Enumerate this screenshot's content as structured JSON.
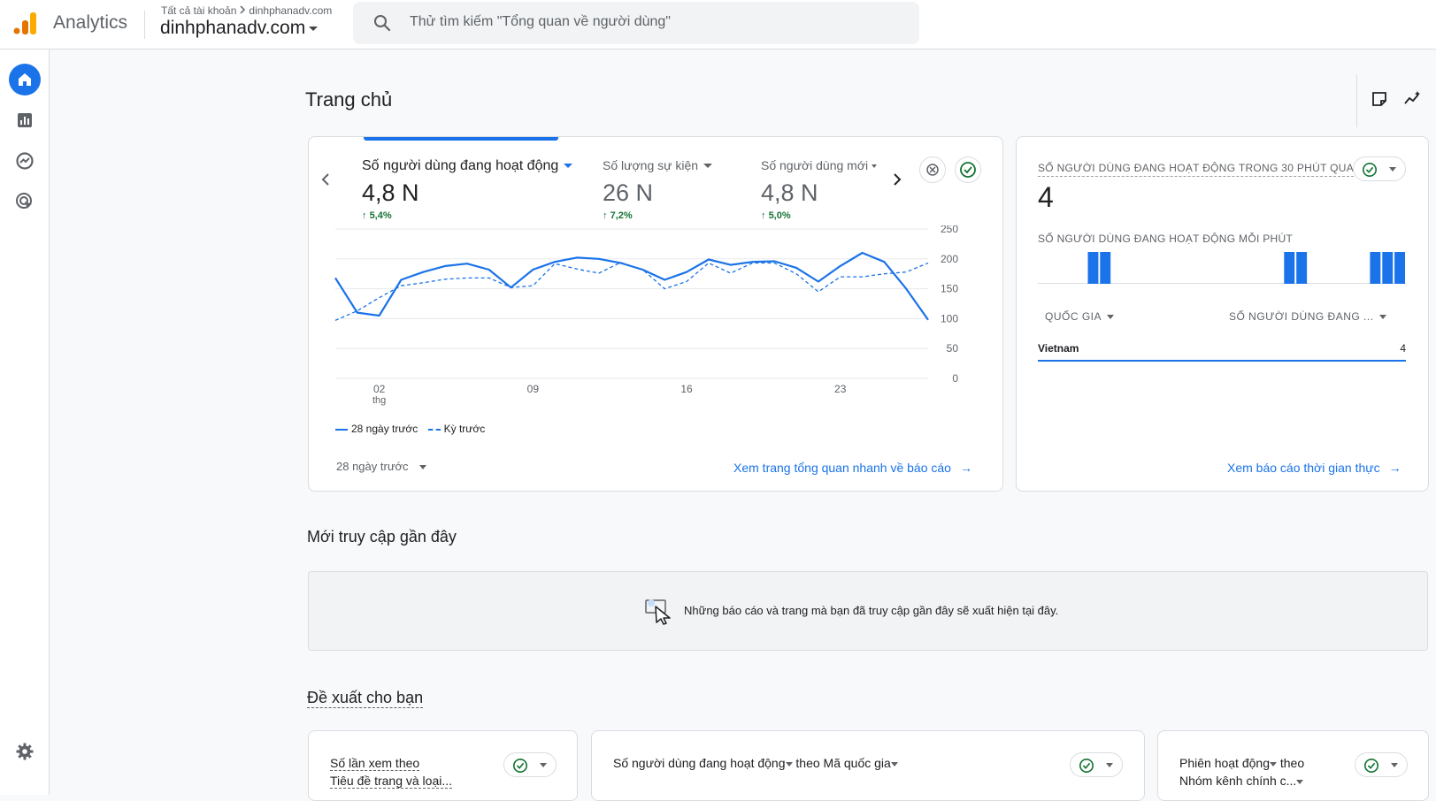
{
  "header": {
    "app_name": "Analytics",
    "breadcrumb_root": "Tất cả tài khoản",
    "breadcrumb_child": "dinhphanadv.com",
    "property": "dinhphanadv.com",
    "search_placeholder": "Thử tìm kiếm \"Tổng quan về người dùng\""
  },
  "nav": {
    "items": [
      "home-icon",
      "reports-icon",
      "explore-icon",
      "advertising-icon"
    ],
    "settings": "gear-icon"
  },
  "page": {
    "title": "Trang chủ"
  },
  "overview": {
    "metrics": [
      {
        "label": "Số người dùng đang hoạt động",
        "value": "4,8 N",
        "delta": "5,4%",
        "selected": true
      },
      {
        "label": "Số lượng sự kiện",
        "value": "26 N",
        "delta": "7,2%"
      },
      {
        "label": "Số người dùng mới",
        "value": "4,8 N",
        "delta": "5,0%"
      }
    ],
    "legend_current": "28 ngày trước",
    "legend_previous": "Kỳ trước",
    "date_range": "28 ngày trước",
    "link": "Xem trang tổng quan nhanh về báo cáo"
  },
  "chart_data": {
    "type": "line",
    "x_tick_labels": [
      "02",
      "09",
      "16",
      "23"
    ],
    "x_tick_sublabel": "thg",
    "ylim": [
      0,
      250
    ],
    "y_ticks": [
      0,
      50,
      100,
      150,
      200,
      250
    ],
    "grid": true,
    "legend_position": "bottom-left",
    "series": [
      {
        "name": "28 ngày trước",
        "style": "solid",
        "color": "#1a73e8",
        "values": [
          168,
          110,
          105,
          165,
          178,
          188,
          192,
          182,
          152,
          182,
          195,
          202,
          200,
          193,
          182,
          165,
          178,
          199,
          190,
          195,
          196,
          185,
          162,
          188,
          210,
          195,
          150,
          98
        ]
      },
      {
        "name": "Kỳ trước",
        "style": "dashed",
        "color": "#1a73e8",
        "values": [
          97,
          113,
          135,
          155,
          160,
          166,
          168,
          168,
          152,
          155,
          192,
          183,
          176,
          194,
          182,
          150,
          162,
          193,
          176,
          193,
          193,
          175,
          145,
          170,
          170,
          175,
          178,
          193
        ]
      }
    ]
  },
  "realtime": {
    "title": "SỐ NGƯỜI DÙNG ĐANG HOẠT ĐỘNG TRONG 30 PHÚT QUA",
    "value": "4",
    "per_minute_title": "SỐ NGƯỜI DÙNG ĐANG HOẠT ĐỘNG MỖI PHÚT",
    "per_minute": [
      0,
      0,
      0,
      0,
      1,
      1,
      0,
      0,
      0,
      0,
      0,
      0,
      0,
      0,
      0,
      0,
      0,
      0,
      0,
      0,
      1,
      1,
      0,
      0,
      0,
      0,
      0,
      1,
      1,
      1
    ],
    "col_country": "QUỐC GIA",
    "col_users": "SỐ NGƯỜI DÙNG ĐANG ...",
    "rows": [
      {
        "country": "Vietnam",
        "users": "4"
      }
    ],
    "link": "Xem báo cáo thời gian thực"
  },
  "recent": {
    "title": "Mới truy cập gần đây",
    "empty_text": "Những báo cáo và trang mà bạn đã truy cập gần đây sẽ xuất hiện tại đây."
  },
  "suggestions": {
    "title": "Đề xuất cho bạn",
    "cards": [
      {
        "line1": "Số lần xem theo",
        "line2": "Tiêu đề trang và loại..."
      },
      {
        "line1a": "Số người dùng đang hoạt động",
        "line1b": "theo",
        "line1c": "Mã quốc gia"
      },
      {
        "line1a": "Phiên hoạt động",
        "line1b": "theo",
        "line2": "Nhóm kênh chính c..."
      }
    ]
  },
  "colors": {
    "accent": "#1a73e8",
    "positive": "#137333"
  }
}
